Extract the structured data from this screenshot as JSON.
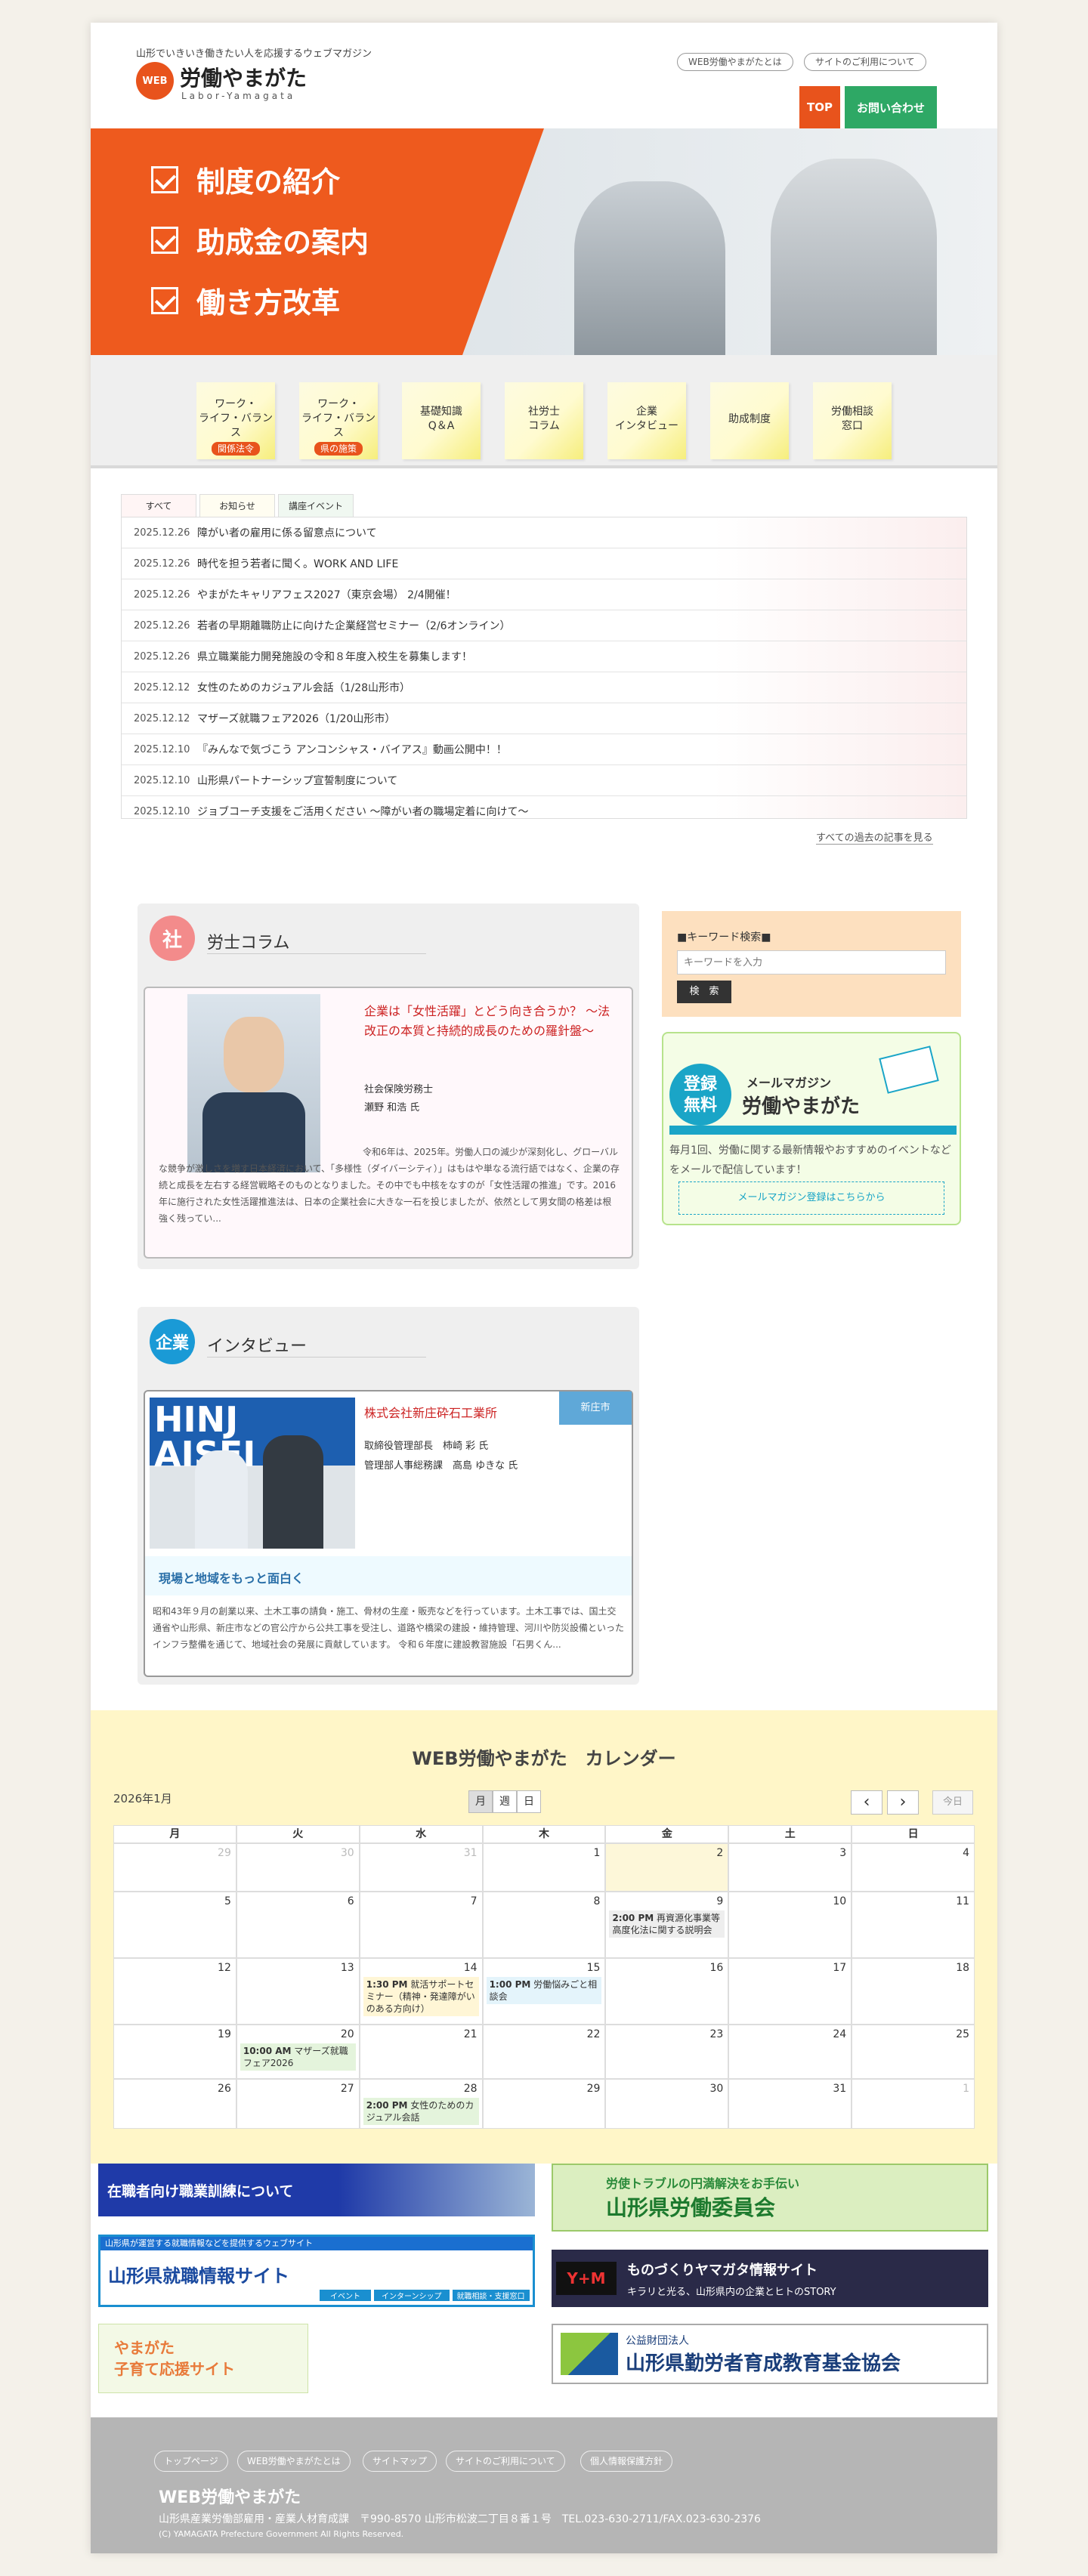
{
  "header": {
    "tagline": "山形でいきいき働きたい人を応援するウェブマガジン",
    "logo_badge": "WEB",
    "logo_text": "労働やまがた",
    "logo_sub": "Labor-Yamagata",
    "links": [
      "WEB労働やまがたとは",
      "サイトのご利用について"
    ],
    "top_button": "TOP",
    "contact_button": "お問い合わせ"
  },
  "hero": {
    "items": [
      "制度の紹介",
      "助成金の案内",
      "働き方改革"
    ]
  },
  "nav": [
    {
      "label": "ワーク・\nライフ・バランス",
      "tag": "関係法令"
    },
    {
      "label": "ワーク・\nライフ・バランス",
      "tag": "県の施策"
    },
    {
      "label": "基礎知識\nQ＆A",
      "tag": ""
    },
    {
      "label": "社労士\nコラム",
      "tag": ""
    },
    {
      "label": "企業\nインタビュー",
      "tag": ""
    },
    {
      "label": "助成制度",
      "tag": ""
    },
    {
      "label": "労働相談\n窓口",
      "tag": ""
    }
  ],
  "news": {
    "tabs": [
      "すべて",
      "お知らせ",
      "講座イベント"
    ],
    "items": [
      {
        "date": "2025.12.26",
        "title": "障がい者の雇用に係る留意点について"
      },
      {
        "date": "2025.12.26",
        "title": "時代を担う若者に聞く。WORK AND LIFE"
      },
      {
        "date": "2025.12.26",
        "title": "やまがたキャリアフェス2027（東京会場） 2/4開催！"
      },
      {
        "date": "2025.12.26",
        "title": "若者の早期離職防止に向けた企業経営セミナー（2/6オンライン）"
      },
      {
        "date": "2025.12.26",
        "title": "県立職業能力開発施設の令和８年度入校生を募集します！"
      },
      {
        "date": "2025.12.12",
        "title": "女性のためのカジュアル会話（1/28山形市）"
      },
      {
        "date": "2025.12.12",
        "title": "マザーズ就職フェア2026（1/20山形市）"
      },
      {
        "date": "2025.12.10",
        "title": "『みんなで気づこう アンコンシャス・バイアス』動画公開中！！"
      },
      {
        "date": "2025.12.10",
        "title": "山形県パートナーシップ宣誓制度について"
      },
      {
        "date": "2025.12.10",
        "title": "ジョブコーチ支援をご活用ください ～障がい者の職場定着に向けて～"
      }
    ],
    "more": "すべての過去の記事を見る"
  },
  "column": {
    "badge": "社",
    "title": "労士コラム",
    "article_title": "企業は「女性活躍」とどう向き合うか？ ～法改正の本質と持続的成長のための羅針盤～",
    "author_role": "社会保険労務士",
    "author_name": "瀬野 和浩 氏",
    "body": "令和6年は、2025年。労働人口の減少が深刻化し、グローバルな競争が激しさを増す日本経済において、「多様性（ダイバーシティ）」はもはや単なる流行語ではなく、企業の存続と成長を左右する経営戦略そのものとなりました。その中でも中核をなすのが「女性活躍の推進」です。2016年に施行された女性活躍推進法は、日本の企業社会に大きな一石を投じましたが、依然として男女間の格差は根強く残ってい..."
  },
  "interview": {
    "badge": "企業",
    "title": "インタビュー",
    "tag": "新庄市",
    "company": "株式会社新庄砕石工業所",
    "person1": "取締役管理部長　柿崎 彩 氏",
    "person2": "管理部人事総務課　高島 ゆきな 氏",
    "photo_text": "HINJ\nAISEI",
    "headline": "現場と地域をもっと面白く",
    "body": "昭和43年９月の創業以来、土木工事の請負・施工、骨材の生産・販売などを行っています。土木工事では、国土交通省や山形県、新庄市などの官公庁から公共工事を受注し、道路や橋梁の建設・維持管理、河川や防災設備といったインフラ整備を通じて、地域社会の発展に貢献しています。 令和６年度に建設教習施設「石男くん..."
  },
  "search": {
    "title": "■キーワード検索■",
    "placeholder": "キーワードを入力",
    "button": "検　索"
  },
  "mail": {
    "badge": "登録\n無料",
    "label": "メールマガジン",
    "title": "労働やまがた",
    "desc": "毎月1回、労働に関する最新情報やおすすめのイベントなどをメールで配信しています！",
    "button": "メールマガジン登録はこちらから"
  },
  "calendar": {
    "title": "WEB労働やまがた　カレンダー",
    "month": "2026年1月",
    "views": [
      "月",
      "週",
      "日"
    ],
    "prev": "‹",
    "next": "›",
    "today": "今日",
    "weekdays": [
      "月",
      "火",
      "水",
      "木",
      "金",
      "土",
      "日"
    ],
    "rows": [
      [
        {
          "d": "29",
          "m": true
        },
        {
          "d": "30",
          "m": true
        },
        {
          "d": "31",
          "m": true
        },
        {
          "d": "1"
        },
        {
          "d": "2",
          "hl": true
        },
        {
          "d": "3"
        },
        {
          "d": "4"
        }
      ],
      [
        {
          "d": "5"
        },
        {
          "d": "6"
        },
        {
          "d": "7"
        },
        {
          "d": "8"
        },
        {
          "d": "9",
          "ev": {
            "time": "2:00 PM",
            "text": "再資源化事業等高度化法に関する説明会",
            "c": "#eeeeee"
          }
        },
        {
          "d": "10"
        },
        {
          "d": "11"
        }
      ],
      [
        {
          "d": "12"
        },
        {
          "d": "13"
        },
        {
          "d": "14",
          "ev": {
            "time": "1:30 PM",
            "text": "就活サポートセミナー（精神・発達障がいのある方向け）",
            "c": "#fff6d6"
          }
        },
        {
          "d": "15",
          "ev": {
            "time": "1:00 PM",
            "text": "労働悩みごと相談会",
            "c": "#e4f4fb"
          }
        },
        {
          "d": "16"
        },
        {
          "d": "17"
        },
        {
          "d": "18"
        }
      ],
      [
        {
          "d": "19"
        },
        {
          "d": "20",
          "ev": {
            "time": "10:00 AM",
            "text": "マザーズ就職フェア2026",
            "c": "#e4f4dc"
          }
        },
        {
          "d": "21"
        },
        {
          "d": "22"
        },
        {
          "d": "23"
        },
        {
          "d": "24"
        },
        {
          "d": "25"
        }
      ],
      [
        {
          "d": "26"
        },
        {
          "d": "27"
        },
        {
          "d": "28",
          "ev": {
            "time": "2:00 PM",
            "text": "女性のためのカジュアル会話",
            "c": "#e4f4dc"
          }
        },
        {
          "d": "29"
        },
        {
          "d": "30"
        },
        {
          "d": "31"
        },
        {
          "d": "1",
          "m": true
        }
      ]
    ]
  },
  "banners": [
    {
      "text": "在職者向け職業訓練について",
      "sub": ""
    },
    {
      "text": "労使トラブルの円満解決をお手伝い",
      "sub": "山形県労働委員会"
    },
    {
      "text": "山形県就職情報サイト",
      "sub": "山形県が運営する就職情報などを提供するウェブサイト",
      "chips": [
        "イベント",
        "インターンシップ",
        "就職相談・支援窓口"
      ]
    },
    {
      "text": "ものづくりヤマガタ情報サイト",
      "sub": "キラリと光る、山形県内の企業とヒトのSTORY",
      "mark": "Y+M"
    },
    {
      "text": "やまがた\n子育て応援サイト",
      "sub": ""
    },
    {
      "text": "山形県勤労者育成教育基金協会",
      "sub": "公益財団法人"
    }
  ],
  "footer": {
    "links": [
      "トップページ",
      "WEB労働やまがたとは",
      "サイトマップ",
      "サイトのご利用について",
      "個人情報保護方針"
    ],
    "title": "WEB労働やまがた",
    "address": "山形県産業労働部雇用・産業人材育成課　〒990-8570 山形市松波二丁目８番１号　TEL.023-630-2711/FAX.023-630-2376",
    "copyright": "(C) YAMAGATA Prefecture Government All Rights Reserved."
  },
  "colors": {
    "accent": "#e8531c",
    "green": "#2ea865",
    "calendar_bg": "#fff6c8",
    "footer": "#b5b5b5"
  }
}
